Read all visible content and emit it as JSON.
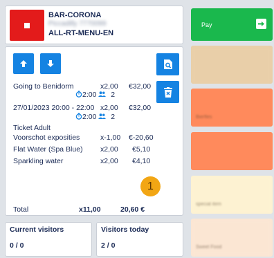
{
  "header": {
    "line1": "BAR-CORONA",
    "line2": "Piccadilly 7770099",
    "line3": "ALL-RT-MENU-EN"
  },
  "order": {
    "items": [
      {
        "name": "Going to Benidorm",
        "qty": "x2,00",
        "amount": "€32,00",
        "sub_time": "2:00",
        "sub_people": "2"
      },
      {
        "name": "27/01/2023 20:00 - 22:00",
        "qty": "x2,00",
        "amount": "€32,00",
        "sub_time": "2:00",
        "sub_people": "2"
      },
      {
        "name": "Ticket Adult",
        "qty": "",
        "amount": ""
      },
      {
        "name": "Voorschot exposities",
        "qty": "x-1,00",
        "amount": "€-20,60"
      },
      {
        "name": "Flat Water (Spa Blue)",
        "qty": "x2,00",
        "amount": "€5,10"
      },
      {
        "name": "Sparkling water",
        "qty": "x2,00",
        "amount": "€4,10"
      }
    ],
    "badge": "1",
    "total_label": "Total",
    "total_qty": "x11,00",
    "total_amount": "20,60 €"
  },
  "visitors": {
    "current_label": "Current visitors",
    "current_value": "0 / 0",
    "today_label": "Visitors today",
    "today_value": "2 / 0"
  },
  "pay": {
    "label": "Pay"
  },
  "tiles": [
    {
      "label": "",
      "color": "#e9cfa9"
    },
    {
      "label": "Bierfles",
      "color": "#ff8a5c"
    },
    {
      "label": "",
      "color": "#ff8a5c"
    },
    {
      "label": "special item",
      "color": "#fdf2d2"
    },
    {
      "label": "Sweet Food",
      "color": "#fbe6d3"
    }
  ],
  "colors": {
    "accent_blue": "#1583e2",
    "stop_red": "#e31b1b",
    "pay_green": "#1ab84d",
    "badge_orange": "#f2a614"
  }
}
